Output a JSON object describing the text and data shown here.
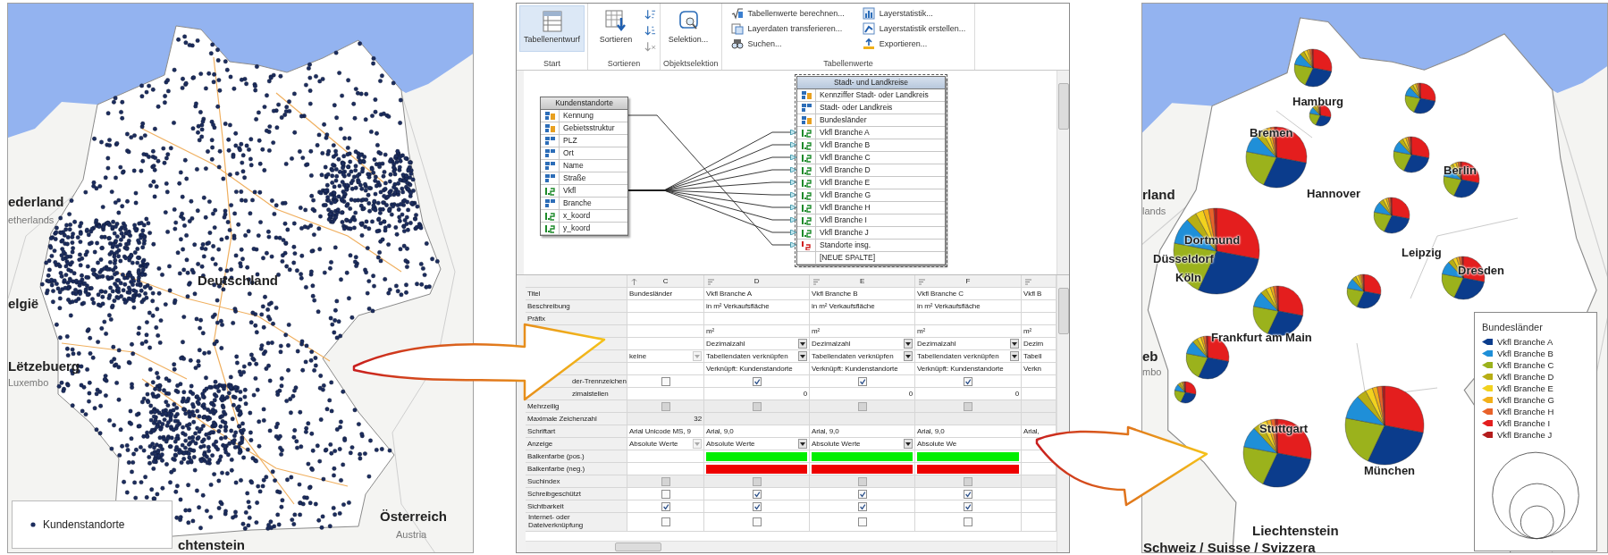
{
  "customer_map": {
    "labels": [
      {
        "text": "ederland",
        "kind": "country"
      },
      {
        "text": "etherlands",
        "kind": "country-alt"
      },
      {
        "text": "elgië",
        "kind": "country"
      },
      {
        "text": "Deutschland",
        "kind": "country"
      },
      {
        "text": "Lëtzebuerg",
        "kind": "country"
      },
      {
        "text": "Luxembo",
        "kind": "country-alt"
      },
      {
        "text": "Österreich",
        "kind": "country"
      },
      {
        "text": "Austria",
        "kind": "country-alt"
      },
      {
        "text": "chtenstein",
        "kind": "country"
      }
    ],
    "legend": {
      "label": "Kundenstandorte"
    }
  },
  "window": {
    "ribbon": {
      "groups": [
        {
          "label": "Start",
          "buttons": [
            {
              "kind": "large",
              "label": "Tabellenentwurf",
              "selected": true
            }
          ]
        },
        {
          "label": "Sortieren",
          "buttons": [
            {
              "kind": "large",
              "label": "Sortieren",
              "selected": false
            },
            {
              "kind": "small",
              "selected": false
            },
            {
              "kind": "small",
              "selected": false
            },
            {
              "kind": "small",
              "selected": false
            }
          ]
        },
        {
          "label": "Objektselektion",
          "buttons": [
            {
              "kind": "large",
              "label": "Selektion...",
              "selected": false
            }
          ]
        },
        {
          "label": "Tabellenwerte",
          "buttons": [
            {
              "kind": "row",
              "label": "Tabellenwerte berechnen...",
              "selected": false
            },
            {
              "kind": "row",
              "label": "Layerdaten transferieren...",
              "selected": false
            },
            {
              "kind": "row",
              "label": "Suchen...",
              "selected": false
            },
            {
              "kind": "row",
              "label": "Layerstatistik...",
              "selected": false
            },
            {
              "kind": "row",
              "label": "Layerstatistik erstellen...",
              "selected": false
            },
            {
              "kind": "row",
              "label": "Exportieren...",
              "selected": false
            }
          ]
        }
      ]
    },
    "diagram": {
      "tables": [
        {
          "title": "Kundenstandorte",
          "selected": false,
          "fields": [
            {
              "name": "Kennung",
              "kind": "key-text"
            },
            {
              "name": "Gebietsstruktur",
              "kind": "key-text"
            },
            {
              "name": "PLZ",
              "kind": "text"
            },
            {
              "name": "Ort",
              "kind": "text"
            },
            {
              "name": "Name",
              "kind": "text"
            },
            {
              "name": "Straße",
              "kind": "text"
            },
            {
              "name": "Vkfl",
              "kind": "number"
            },
            {
              "name": "Branche",
              "kind": "text"
            },
            {
              "name": "x_koord",
              "kind": "number"
            },
            {
              "name": "y_koord",
              "kind": "number"
            }
          ]
        },
        {
          "title": "Stadt- und Landkreise",
          "selected": true,
          "fields": [
            {
              "name": "Kennziffer Stadt- oder Landkreis",
              "kind": "key-text"
            },
            {
              "name": "Stadt- oder Landkreis",
              "kind": "text"
            },
            {
              "name": "Bundesländer",
              "kind": "key-text"
            },
            {
              "name": "Vkfl Branche A",
              "kind": "number"
            },
            {
              "name": "Vkfl Branche B",
              "kind": "number"
            },
            {
              "name": "Vkfl Branche C",
              "kind": "number"
            },
            {
              "name": "Vkfl Branche D",
              "kind": "number"
            },
            {
              "name": "Vkfl Branche E",
              "kind": "number"
            },
            {
              "name": "Vkfl Branche G",
              "kind": "number"
            },
            {
              "name": "Vkfl Branche H",
              "kind": "number"
            },
            {
              "name": "Vkfl Branche I",
              "kind": "number"
            },
            {
              "name": "Vkfl Branche J",
              "kind": "number"
            },
            {
              "name": "Standorte insg.",
              "kind": "count"
            },
            {
              "name": "[NEUE SPALTE]",
              "kind": "new"
            }
          ]
        }
      ]
    },
    "grid": {
      "columns": [
        {
          "letter": "C",
          "kind": "key"
        },
        {
          "letter": "D",
          "kind": "value"
        },
        {
          "letter": "E",
          "kind": "value"
        },
        {
          "letter": "F",
          "kind": "value"
        },
        {
          "kind": "value"
        }
      ],
      "rows": [
        {
          "label": "Titel",
          "disabled": false,
          "cells": [
            {
              "kind": "text",
              "text": "Bundesländer"
            },
            {
              "kind": "text",
              "text": "Vkfl Branche A"
            },
            {
              "kind": "text",
              "text": "Vkfl Branche B"
            },
            {
              "kind": "text",
              "text": "Vkfl Branche C"
            },
            {
              "kind": "text",
              "text": "Vkfl B"
            }
          ]
        },
        {
          "label": "Beschreibung",
          "disabled": false,
          "cells": [
            {
              "kind": "empty"
            },
            {
              "kind": "text",
              "text": "in m² Verkaufsfläche"
            },
            {
              "kind": "text",
              "text": "in m² Verkaufsfläche"
            },
            {
              "kind": "text",
              "text": "in m² Verkaufsfläche"
            },
            {
              "kind": "empty"
            }
          ]
        },
        {
          "label": "Präfix",
          "disabled": false,
          "cells": [
            {
              "kind": "empty"
            },
            {
              "kind": "empty"
            },
            {
              "kind": "empty"
            },
            {
              "kind": "empty"
            },
            {
              "kind": "empty"
            }
          ]
        },
        {
          "disabled": false,
          "cells": [
            {
              "kind": "empty"
            },
            {
              "kind": "text",
              "text": "m²"
            },
            {
              "kind": "text",
              "text": "m²"
            },
            {
              "kind": "text",
              "text": "m²"
            },
            {
              "kind": "text",
              "text": "m²"
            }
          ]
        },
        {
          "disabled": false,
          "cells": [
            {
              "kind": "empty"
            },
            {
              "kind": "dropdown",
              "text": "Dezimalzahl",
              "disabled": false
            },
            {
              "kind": "dropdown",
              "text": "Dezimalzahl",
              "disabled": false
            },
            {
              "kind": "dropdown",
              "text": "Dezimalzahl",
              "disabled": false
            },
            {
              "kind": "text",
              "text": "Dezim"
            }
          ]
        },
        {
          "disabled": false,
          "cells": [
            {
              "kind": "dropdown",
              "text": "keine",
              "disabled": true
            },
            {
              "kind": "dropdown",
              "text": "Tabellendaten verknüpfen",
              "disabled": false
            },
            {
              "kind": "dropdown",
              "text": "Tabellendaten verknüpfen",
              "disabled": false
            },
            {
              "kind": "dropdown",
              "text": "Tabellendaten verknüpfen",
              "disabled": false
            },
            {
              "kind": "text",
              "text": "Tabell"
            }
          ]
        },
        {
          "disabled": false,
          "cells": [
            {
              "kind": "empty"
            },
            {
              "kind": "text",
              "text": "Verknüpft: Kundenstandorte"
            },
            {
              "kind": "text",
              "text": "Verknüpft: Kundenstandorte"
            },
            {
              "kind": "text",
              "text": "Verknüpft: Kundenstandorte"
            },
            {
              "kind": "text",
              "text": "Verkn"
            }
          ]
        },
        {
          "label": "der-Trennzeichen",
          "disabled": false,
          "cells": [
            {
              "kind": "checkbox",
              "checked": false
            },
            {
              "kind": "checkbox",
              "checked": true
            },
            {
              "kind": "checkbox",
              "checked": true
            },
            {
              "kind": "checkbox",
              "checked": true
            },
            {
              "kind": "empty"
            }
          ]
        },
        {
          "label": "zimalstellen",
          "disabled": false,
          "cells": [
            {
              "kind": "empty"
            },
            {
              "kind": "number",
              "text": "0"
            },
            {
              "kind": "number",
              "text": "0"
            },
            {
              "kind": "number",
              "text": "0"
            },
            {
              "kind": "empty"
            }
          ]
        },
        {
          "label": "Mehrzeilig",
          "disabled": true,
          "cells": [
            {
              "kind": "checkbox",
              "checked": false
            },
            {
              "kind": "checkbox",
              "checked": false
            },
            {
              "kind": "checkbox",
              "checked": false
            },
            {
              "kind": "checkbox",
              "checked": false
            },
            {
              "kind": "empty"
            }
          ]
        },
        {
          "label": "Maximale Zeichenzahl",
          "disabled": true,
          "cells": [
            {
              "kind": "number",
              "text": "32"
            },
            {
              "kind": "empty"
            },
            {
              "kind": "empty"
            },
            {
              "kind": "empty"
            },
            {
              "kind": "empty"
            }
          ]
        },
        {
          "label": "Schriftart",
          "disabled": false,
          "cells": [
            {
              "kind": "text",
              "text": "Arial Unicode MS, 9"
            },
            {
              "kind": "text",
              "text": "Arial, 9,0"
            },
            {
              "kind": "text",
              "text": "Arial, 9,0"
            },
            {
              "kind": "text",
              "text": "Arial, 9,0"
            },
            {
              "kind": "text",
              "text": "Arial,"
            }
          ]
        },
        {
          "label": "Anzeige",
          "disabled": false,
          "cells": [
            {
              "kind": "dropdown",
              "text": "Absolute Werte",
              "disabled": true
            },
            {
              "kind": "dropdown",
              "text": "Absolute Werte",
              "disabled": false
            },
            {
              "kind": "dropdown",
              "text": "Absolute Werte",
              "disabled": false
            },
            {
              "kind": "text",
              "text": "Absolute We"
            },
            {
              "kind": "empty"
            }
          ]
        },
        {
          "label": "Balkenfarbe (pos.)",
          "disabled": false,
          "cells": [
            {
              "kind": "empty"
            },
            {
              "kind": "color",
              "color": "#00ee00"
            },
            {
              "kind": "color",
              "color": "#00ee00"
            },
            {
              "kind": "color",
              "color": "#00ee00"
            },
            {
              "kind": "empty"
            }
          ]
        },
        {
          "label": "Balkenfarbe (neg.)",
          "disabled": false,
          "cells": [
            {
              "kind": "empty"
            },
            {
              "kind": "color",
              "color": "#ee0000"
            },
            {
              "kind": "color",
              "color": "#ee0000"
            },
            {
              "kind": "color",
              "color": "#ee0000"
            },
            {
              "kind": "empty"
            }
          ]
        },
        {
          "label": "Suchindex",
          "disabled": true,
          "cells": [
            {
              "kind": "checkbox",
              "checked": false
            },
            {
              "kind": "checkbox",
              "checked": false
            },
            {
              "kind": "checkbox",
              "checked": false
            },
            {
              "kind": "checkbox",
              "checked": false
            },
            {
              "kind": "empty"
            }
          ]
        },
        {
          "label": "Schreibgeschützt",
          "disabled": false,
          "cells": [
            {
              "kind": "checkbox",
              "checked": false
            },
            {
              "kind": "checkbox",
              "checked": true
            },
            {
              "kind": "checkbox",
              "checked": true
            },
            {
              "kind": "checkbox",
              "checked": true
            },
            {
              "kind": "empty"
            }
          ]
        },
        {
          "label": "Sichtbarkeit",
          "disabled": false,
          "cells": [
            {
              "kind": "checkbox",
              "checked": true
            },
            {
              "kind": "checkbox",
              "checked": true
            },
            {
              "kind": "checkbox",
              "checked": true
            },
            {
              "kind": "checkbox",
              "checked": true
            },
            {
              "kind": "empty"
            }
          ]
        },
        {
          "label": "Internet- oder Dateiverknüpfung",
          "disabled": false,
          "cells": [
            {
              "kind": "checkbox",
              "checked": false
            },
            {
              "kind": "checkbox",
              "checked": false
            },
            {
              "kind": "checkbox",
              "checked": false
            },
            {
              "kind": "checkbox",
              "checked": false
            },
            {
              "kind": "empty"
            }
          ]
        }
      ]
    }
  },
  "branch_map": {
    "labels": [
      {
        "text": "rland",
        "kind": "country"
      },
      {
        "text": "lands",
        "kind": "country-alt"
      },
      {
        "text": "Hamburg",
        "kind": "city"
      },
      {
        "text": "Bremen",
        "kind": "city"
      },
      {
        "text": "Hannover",
        "kind": "city"
      },
      {
        "text": "Berlin",
        "kind": "city"
      },
      {
        "text": "Dortmund",
        "kind": "city"
      },
      {
        "text": "Düsseldorf",
        "kind": "city"
      },
      {
        "text": "Köln",
        "kind": "city"
      },
      {
        "text": "Leipzig",
        "kind": "city"
      },
      {
        "text": "Dresden",
        "kind": "city"
      },
      {
        "text": "Frankfurt am Main",
        "kind": "city"
      },
      {
        "text": "eb",
        "kind": "country"
      },
      {
        "text": "mbo",
        "kind": "country-alt"
      },
      {
        "text": "Stuttgart",
        "kind": "city"
      },
      {
        "text": "München",
        "kind": "city"
      },
      {
        "text": "Liechtenstein",
        "kind": "country"
      },
      {
        "text": "Schweiz / Suisse / Svizzera",
        "kind": "country"
      }
    ],
    "legend": {
      "title": "Bundesländer",
      "items": [
        {
          "label": "Vkfl Branche A",
          "color": "#0b3c8c"
        },
        {
          "label": "Vkfl Branche B",
          "color": "#1f8fd8"
        },
        {
          "label": "Vkfl Branche C",
          "color": "#9bb21c"
        },
        {
          "label": "Vkfl Branche D",
          "color": "#b8ae14"
        },
        {
          "label": "Vkfl Branche E",
          "color": "#f2d21e"
        },
        {
          "label": "Vkfl Branche G",
          "color": "#f2b01a"
        },
        {
          "label": "Vkfl Branche H",
          "color": "#e8622a"
        },
        {
          "label": "Vkfl Branche I",
          "color": "#e41e1e"
        },
        {
          "label": "Vkfl Branche J",
          "color": "#b41c1c"
        }
      ]
    }
  }
}
